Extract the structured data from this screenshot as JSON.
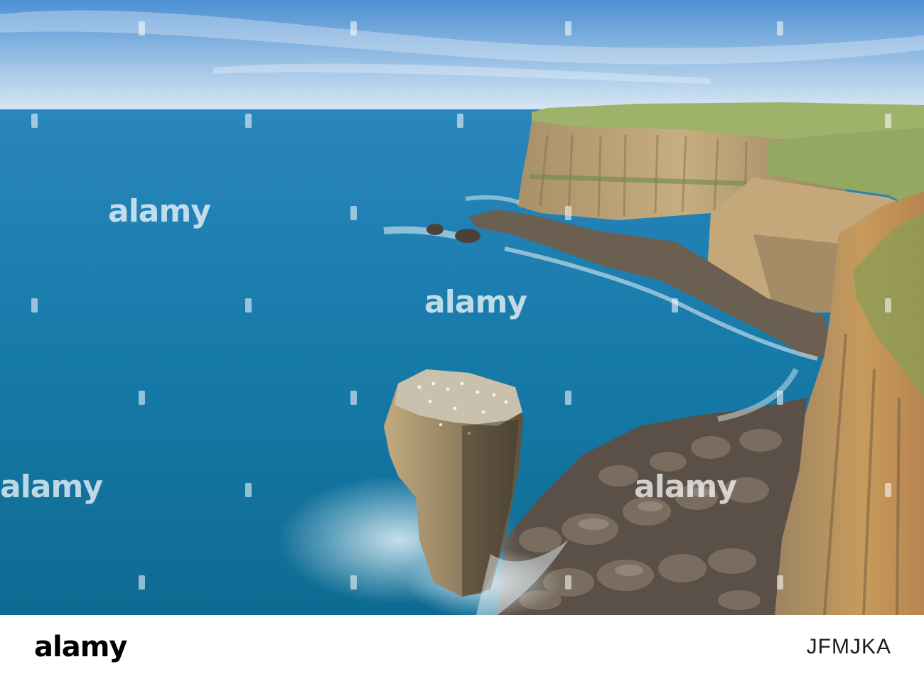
{
  "watermark": {
    "text": "alamy"
  },
  "footer": {
    "logo": "alamy",
    "image_id": "JFMJKA"
  },
  "colors": {
    "sky_top": "#4a8fd4",
    "sky_bottom": "#cfe3f2",
    "sea_far": "#1f7fb3",
    "sea_near": "#0f6f9a",
    "cliff": "#b8a27a",
    "grass": "#8fa65a"
  }
}
